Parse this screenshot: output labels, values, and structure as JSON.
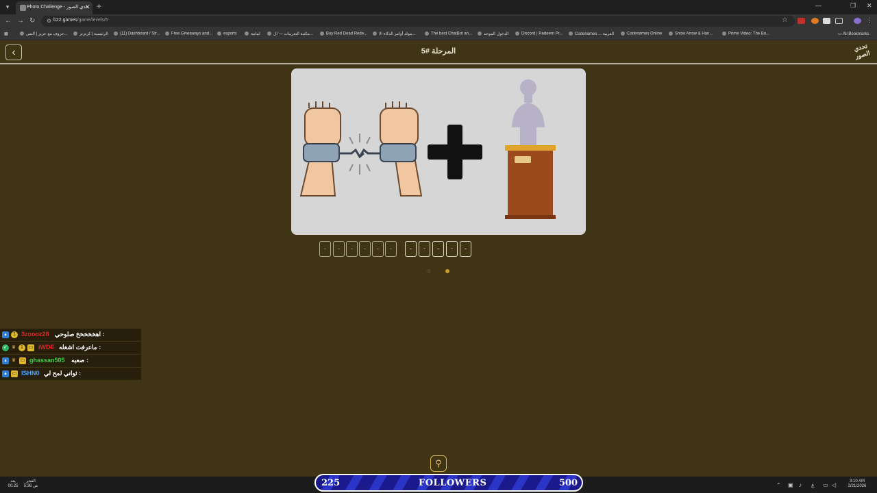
{
  "browser": {
    "tab_title": "Photo Challenge - تحدي الصور",
    "url_host": "b22.games",
    "url_path": "/game/levels/5",
    "all_bookmarks": "All Bookmarks",
    "bookmarks": [
      "حروف مع عزيز | التس...",
      "الرئيسية | كرتزنز",
      "(11) Dashboard / Str...",
      "Free Giveaways and...",
      "esports",
      "لمانية",
      "مكتبة التعريبات — ال...",
      "Buy Red Dead Rede...",
      "مولد أوامر الذكاء الا...",
      "The best ChatBot an...",
      "الدخول الموحد",
      "Discord | Redeem Pr...",
      "Codenames ... العربية",
      "Codenames Online",
      "Snow Arrow & Han...",
      "Prime Video: The Bo..."
    ]
  },
  "game": {
    "level_title": "المرحلة #5",
    "logo_text": "تحدي الصور",
    "slots_word1": [
      "-",
      "-",
      "-",
      "-",
      "-",
      "-"
    ],
    "slots_word2": [
      "-",
      "-",
      "-",
      "-",
      "-"
    ]
  },
  "chat": [
    {
      "user": "3zoooz28",
      "message": "اهخخخخخ صلوحي :",
      "user_color": "#e0282a"
    },
    {
      "user": "iWDE",
      "message": "ماعرفت اشغله :",
      "user_color": "#e0282a"
    },
    {
      "user": "ghassan505",
      "message": "صعبه :",
      "user_color": "#3ed14a"
    },
    {
      "user": "ISHN0",
      "message": "ثواني لمح لي :",
      "user_color": "#4aa3ff"
    }
  ],
  "followers": {
    "current": "225",
    "label": "FOLLOWERS",
    "goal": "500"
  },
  "taskbar": {
    "left_top": "يعد",
    "left_bottom": "00:25",
    "prayer_top": "الفجر",
    "prayer_bottom": "5:36 ص",
    "time": "3:10 AM",
    "date": "2/21/2026",
    "lang": "ع"
  },
  "colors": {
    "background": "#3f3414",
    "card": "#d6d6d6",
    "accent": "#d8b354"
  }
}
